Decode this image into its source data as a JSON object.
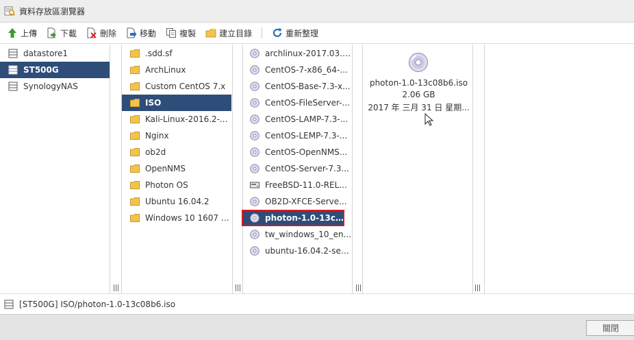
{
  "window": {
    "title": "資料存放區瀏覽器"
  },
  "toolbar": {
    "buttons": [
      {
        "label": "上傳",
        "icon": "upload-icon"
      },
      {
        "label": "下載",
        "icon": "download-icon"
      },
      {
        "label": "刪除",
        "icon": "delete-icon"
      },
      {
        "label": "移動",
        "icon": "move-icon"
      },
      {
        "label": "複製",
        "icon": "copy-icon"
      },
      {
        "label": "建立目錄",
        "icon": "new-folder-icon"
      },
      {
        "label": "重新整理",
        "icon": "refresh-icon"
      }
    ]
  },
  "columns": {
    "datastores": {
      "items": [
        "datastore1",
        "ST500G",
        "SynologyNAS"
      ],
      "selected_index": 1
    },
    "folders": {
      "items": [
        ".sdd.sf",
        "ArchLinux",
        "Custom CentOS 7.x",
        "ISO",
        "Kali-Linux-2016.2-v...",
        "Nginx",
        "ob2d",
        "OpenNMS",
        "Photon OS",
        "Ubuntu 16.04.2",
        "Windows 10 1607 1..."
      ],
      "selected_index": 3
    },
    "files": {
      "items": [
        {
          "name": "archlinux-2017.03.0...",
          "icon": "disc-icon"
        },
        {
          "name": "CentOS-7-x86_64-...",
          "icon": "disc-icon"
        },
        {
          "name": "CentOS-Base-7.3-x...",
          "icon": "disc-icon"
        },
        {
          "name": "CentOS-FileServer-...",
          "icon": "disc-icon"
        },
        {
          "name": "CentOS-LAMP-7.3-...",
          "icon": "disc-icon"
        },
        {
          "name": "CentOS-LEMP-7.3-...",
          "icon": "disc-icon"
        },
        {
          "name": "CentOS-OpenNMS...",
          "icon": "disc-icon"
        },
        {
          "name": "CentOS-Server-7.3...",
          "icon": "disc-icon"
        },
        {
          "name": "FreeBSD-11.0-REL...",
          "icon": "hard-disk-icon"
        },
        {
          "name": "OB2D-XFCE-Serve...",
          "icon": "disc-icon"
        },
        {
          "name": "photon-1.0-13c08b...",
          "icon": "disc-icon"
        },
        {
          "name": "tw_windows_10_en...",
          "icon": "disc-icon"
        },
        {
          "name": "ubuntu-16.04.2-ser...",
          "icon": "disc-icon"
        }
      ],
      "selected_index": 10
    }
  },
  "detail": {
    "name": "photon-1.0-13c08b6.iso",
    "size": "2.06 GB",
    "date": "2017 年 三月 31 日 星期..."
  },
  "status": {
    "path": "[ST500G] ISO/photon-1.0-13c08b6.iso"
  },
  "footer": {
    "close_label": "關閉"
  },
  "colors": {
    "selection": "#2e4d78",
    "highlight_border": "#d71920",
    "folder": "#f2c44d"
  }
}
